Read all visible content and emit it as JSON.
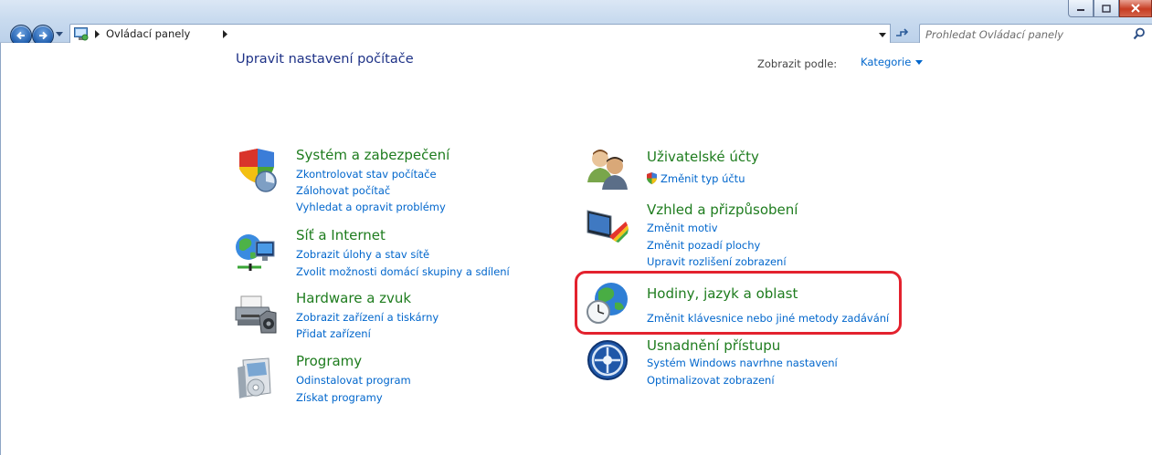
{
  "breadcrumb": {
    "label": "Ovládací panely"
  },
  "search": {
    "placeholder": "Prohledat Ovládací panely"
  },
  "page": {
    "title": "Upravit nastavení počítače",
    "view_by_label": "Zobrazit podle:",
    "view_by_value": "Kategorie"
  },
  "categories": [
    {
      "title": "Systém a zabezpečení",
      "icon": "shield-icon",
      "links": [
        "Zkontrolovat stav počítače",
        "Zálohovat počítač",
        "Vyhledat a opravit problémy"
      ]
    },
    {
      "title": "Síť a Internet",
      "icon": "network-icon",
      "links": [
        "Zobrazit úlohy a stav sítě",
        "Zvolit možnosti domácí skupiny a sdílení"
      ]
    },
    {
      "title": "Hardware a zvuk",
      "icon": "printer-icon",
      "links": [
        "Zobrazit zařízení a tiskárny",
        "Přidat zařízení"
      ]
    },
    {
      "title": "Programy",
      "icon": "programs-icon",
      "links": [
        "Odinstalovat program",
        "Získat programy"
      ]
    },
    {
      "title": "Uživatelské účty",
      "icon": "users-icon",
      "links": [
        "Změnit typ účtu"
      ]
    },
    {
      "title": "Vzhled a přizpůsobení",
      "icon": "appearance-icon",
      "links": [
        "Změnit motiv",
        "Změnit pozadí plochy",
        "Upravit rozlišení zobrazení"
      ]
    },
    {
      "title": "Hodiny, jazyk a oblast",
      "icon": "clock-globe-icon",
      "links": [
        "Změnit klávesnice nebo jiné metody zadávání"
      ]
    },
    {
      "title": "Usnadnění přístupu",
      "icon": "accessibility-icon",
      "links": [
        "Systém Windows navrhne nastavení",
        "Optimalizovat zobrazení"
      ]
    }
  ],
  "colors": {
    "category_title": "#1e7c1e",
    "link": "#0066cc",
    "highlight": "#e3222e"
  }
}
